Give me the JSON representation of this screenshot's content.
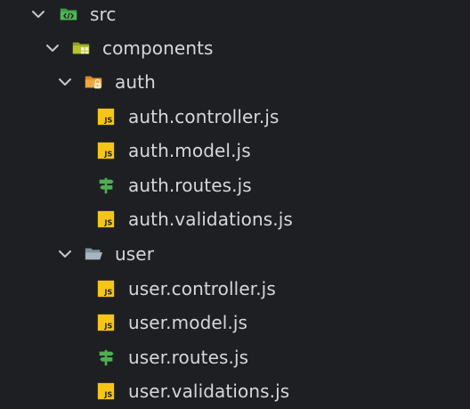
{
  "tree": {
    "src": {
      "label": "src",
      "icon": "code-folder-icon",
      "expanded": true
    },
    "components": {
      "label": "components",
      "icon": "components-folder-icon",
      "expanded": true
    },
    "auth": {
      "label": "auth",
      "icon": "lock-folder-icon",
      "expanded": true,
      "files": [
        {
          "label": "auth.controller.js",
          "icon": "js-file-icon"
        },
        {
          "label": "auth.model.js",
          "icon": "js-file-icon"
        },
        {
          "label": "auth.routes.js",
          "icon": "routes-signpost-icon"
        },
        {
          "label": "auth.validations.js",
          "icon": "js-file-icon"
        }
      ]
    },
    "user": {
      "label": "user",
      "icon": "folder-open-icon",
      "expanded": true,
      "files": [
        {
          "label": "user.controller.js",
          "icon": "js-file-icon"
        },
        {
          "label": "user.model.js",
          "icon": "js-file-icon"
        },
        {
          "label": "user.routes.js",
          "icon": "routes-signpost-icon"
        },
        {
          "label": "user.validations.js",
          "icon": "js-file-icon"
        }
      ]
    }
  },
  "colors": {
    "background": "#1e1f22",
    "text": "#d4d7dc",
    "chevron": "#c5c8ce",
    "js_badge": "#f5c518",
    "routes_green": "#4caf50",
    "src_folder": "#3f9c46",
    "components_folder": "#a7b92b",
    "auth_folder": "#e8a13a",
    "user_folder": "#90a4ae"
  }
}
